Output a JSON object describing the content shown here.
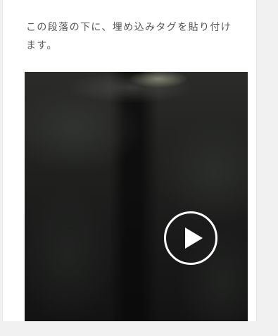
{
  "article": {
    "paragraph": "この段落の下に、埋め込みタグを貼り付けます。"
  },
  "video": {
    "play_icon": "play-icon"
  },
  "colors": {
    "page_background": "#f1f1f1",
    "card_background": "#ffffff",
    "text": "#555555",
    "play_control": "#ffffff"
  }
}
